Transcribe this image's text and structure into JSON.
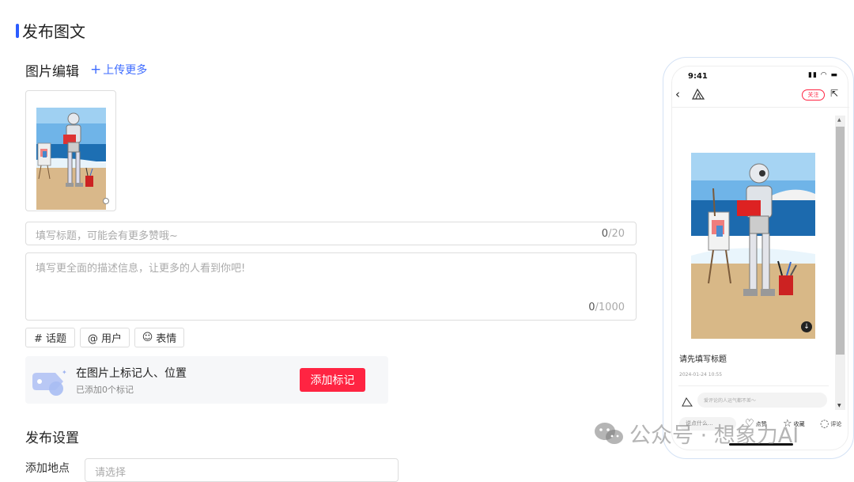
{
  "page": {
    "title": "发布图文"
  },
  "image_edit": {
    "title": "图片编辑",
    "upload_more": "上传更多",
    "upload_more_icon": "plus-icon"
  },
  "title_input": {
    "placeholder": "填写标题，可能会有更多赞哦~",
    "count_current": "0",
    "count_max": "/20"
  },
  "desc_input": {
    "placeholder": "填写更全面的描述信息，让更多的人看到你吧!",
    "count_current": "0",
    "count_max": "/1000"
  },
  "chips": {
    "topic": "# 话题",
    "user": "@ 用户",
    "emoji_icon": "smile-icon",
    "emoji": "表情"
  },
  "mark_panel": {
    "title": "在图片上标记人、位置",
    "subtitle": "已添加0个标记",
    "button": "添加标记",
    "icon": "tag-icon"
  },
  "publish_settings": {
    "title": "发布设置",
    "location_label": "添加地点",
    "location_placeholder": "请选择"
  },
  "phone_preview": {
    "time": "9:41",
    "status_icons": "signal-wifi-battery",
    "follow": "关注",
    "post_title": "请先填写标题",
    "date": "2024-01-24 10:55",
    "comment_placeholder": "爱评论的人运气都不差～",
    "bottom_input": "说点什么...",
    "like": "点赞",
    "collect": "收藏",
    "comment": "评论"
  },
  "watermark": {
    "text": "公众号 · 想象力AI"
  },
  "colors": {
    "accent_blue": "#2b5cff",
    "brand_red": "#ff2442"
  }
}
